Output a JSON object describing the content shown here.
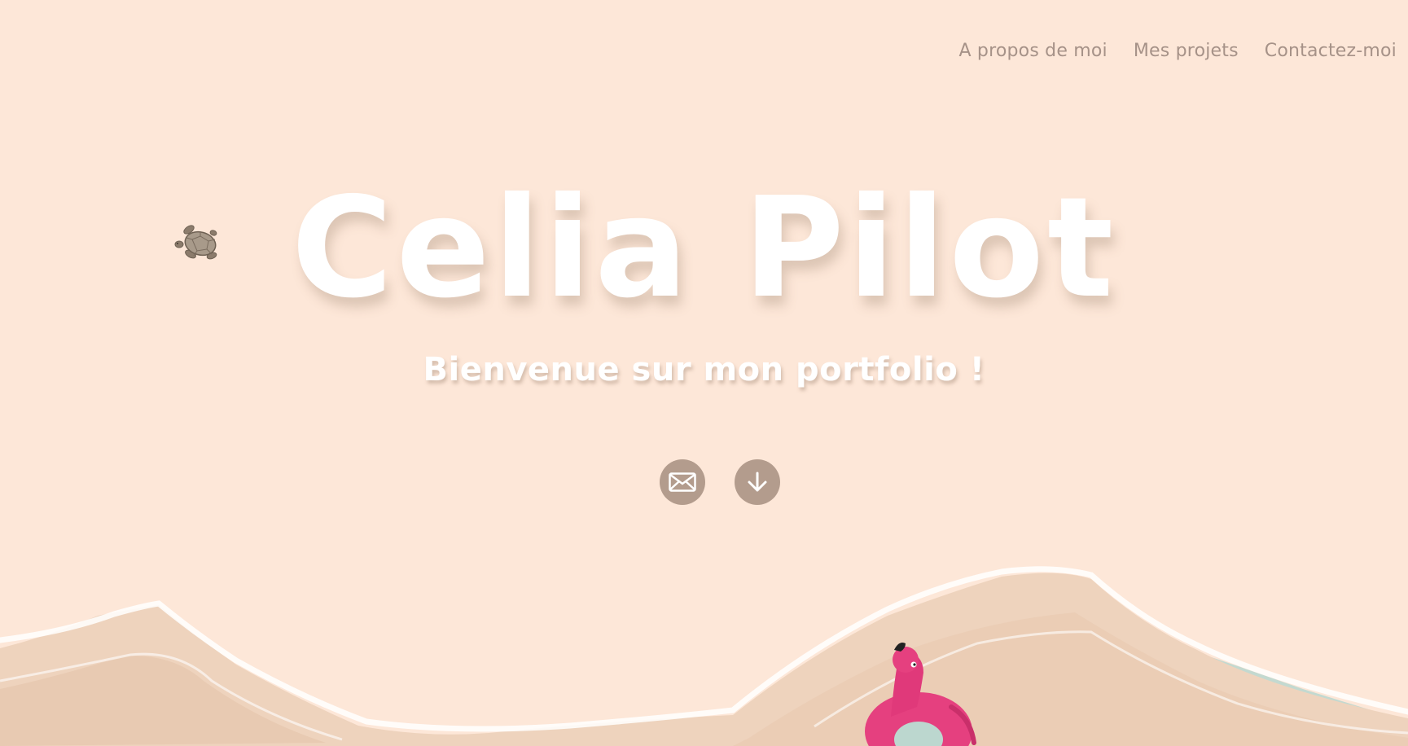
{
  "nav": {
    "items": [
      {
        "label": "A propos de moi"
      },
      {
        "label": "Mes projets"
      },
      {
        "label": "Contactez-moi"
      }
    ]
  },
  "hero": {
    "title": "Celia Pilot",
    "subtitle": "Bienvenue sur mon portfolio !"
  },
  "actions": {
    "mail_icon": "mail-icon",
    "download_icon": "arrow-down-icon"
  },
  "colors": {
    "background": "#fde7d8",
    "nav_text": "#a69288",
    "button": "#b39c8d",
    "title": "#ffffff",
    "flamingo": "#e5407f"
  }
}
